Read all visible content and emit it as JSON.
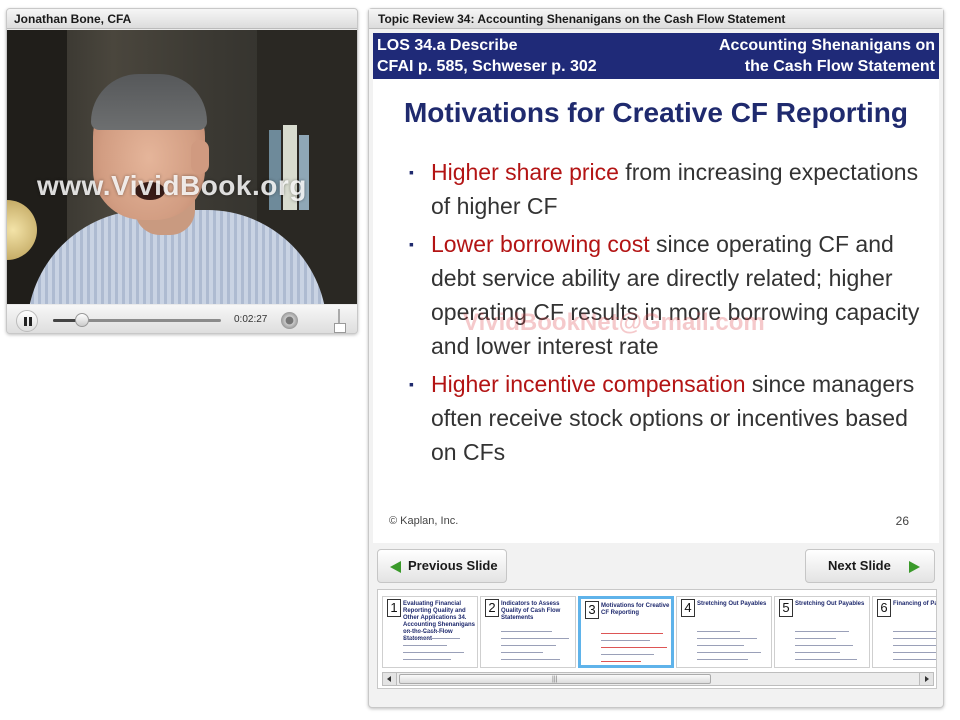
{
  "video": {
    "presenter": "Jonathan Bone, CFA",
    "watermark": "www.VividBook.org",
    "controls": {
      "time": "0:02:27",
      "progress": 0.17
    }
  },
  "slide_panel": {
    "title": "Topic Review 34: Accounting Shenanigans on the Cash Flow Statement",
    "header": {
      "los_line1": "LOS 34.a Describe",
      "los_line2": "CFAI p. 585, Schweser p. 302",
      "topic_line1": "Accounting Shenanigans on",
      "topic_line2": "the Cash Flow Statement"
    },
    "heading": "Motivations for Creative CF Reporting",
    "bullets": [
      {
        "highlight": "Higher share price",
        "rest": " from increasing expectations of higher CF"
      },
      {
        "highlight": "Lower borrowing cost",
        "rest": " since operating CF and debt service ability are directly related; higher operating CF results in more borrowing capacity and lower interest rate"
      },
      {
        "highlight": "Higher incentive compensation",
        "rest": " since managers often receive stock options or incentives based on CFs"
      }
    ],
    "watermark": "VividBookNet@Gmail.com",
    "copyright": "© Kaplan, Inc.",
    "page_number": "26",
    "prev_label": "Previous Slide",
    "next_label": "Next Slide"
  },
  "thumbnails": [
    {
      "num": "1",
      "title": "Evaluating Financial Reporting Quality and Other Applications 34. Accounting Shenanigans on the Cash Flow Statement",
      "active": false
    },
    {
      "num": "2",
      "title": "Indicators to Assess Quality of Cash Flow Statements",
      "active": false
    },
    {
      "num": "3",
      "title": "Motivations for Creative CF Reporting",
      "active": true
    },
    {
      "num": "4",
      "title": "Stretching Out Payables",
      "active": false
    },
    {
      "num": "5",
      "title": "Stretching Out Payables",
      "active": false
    },
    {
      "num": "6",
      "title": "Financing of Payables",
      "active": false
    }
  ],
  "colors": {
    "header_bg": "#1f2a78",
    "heading": "#1f2a6e",
    "highlight": "#b31414",
    "arrow": "#3a9a2a",
    "active_thumb": "#5fb3ea"
  },
  "icons": {
    "pause": "pause-icon",
    "volume": "volume-icon",
    "prev": "green-left-arrow-icon",
    "next": "green-right-arrow-icon"
  }
}
